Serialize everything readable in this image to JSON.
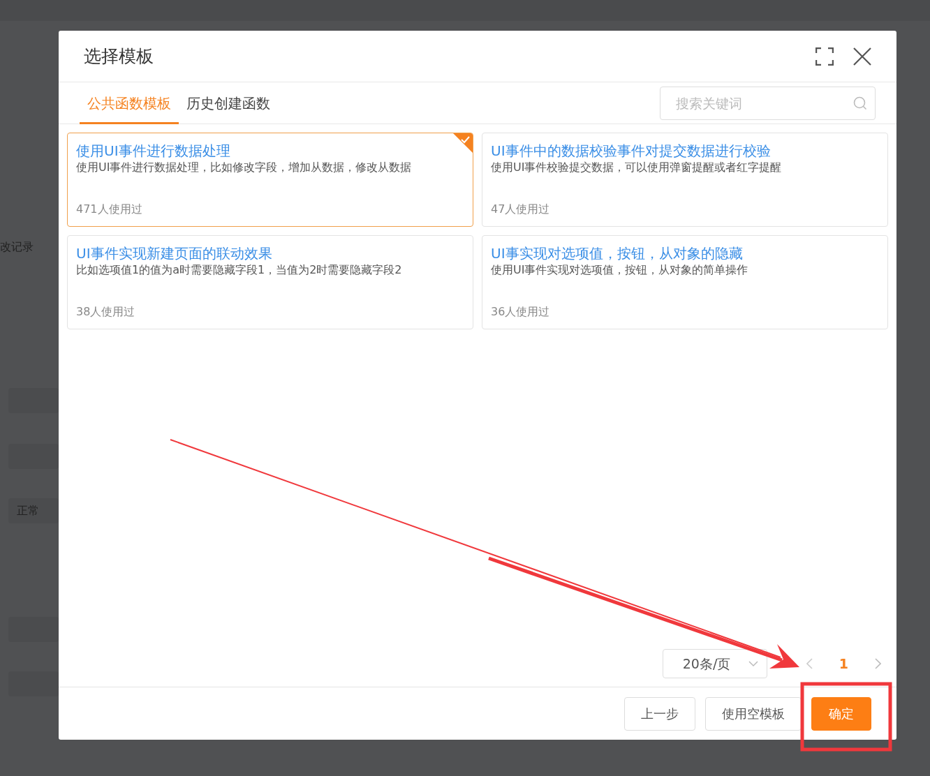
{
  "background": {
    "tab_label": "改记录",
    "status_value": "正常"
  },
  "dialog": {
    "title": "选择模板",
    "tabs": [
      {
        "label": "公共函数模板",
        "selected": true
      },
      {
        "label": "历史创建函数",
        "selected": false
      }
    ],
    "search": {
      "placeholder": "搜索关键词"
    },
    "templates": [
      {
        "title": "使用UI事件进行数据处理",
        "description": "使用UI事件进行数据处理，比如修改字段，增加从数据，修改从数据",
        "usage": "471人使用过",
        "selected": true
      },
      {
        "title": "UI事件中的数据校验事件对提交数据进行校验",
        "description": "使用UI事件校验提交数据，可以使用弹窗提醒或者红字提醒",
        "usage": "47人使用过",
        "selected": false
      },
      {
        "title": "UI事件实现新建页面的联动效果",
        "description": "比如选项值1的值为a时需要隐藏字段1，当值为2时需要隐藏字段2",
        "usage": "38人使用过",
        "selected": false
      },
      {
        "title": "UI事实现对选项值，按钮，从对象的隐藏",
        "description": "使用UI事件实现对选项值，按钮，从对象的简单操作",
        "usage": "36人使用过",
        "selected": false
      }
    ],
    "pagination": {
      "page_size": "20条/页",
      "pages": [
        {
          "label": "1",
          "selected": true
        }
      ]
    },
    "buttons": [
      {
        "label": "上一步",
        "kind": "default"
      },
      {
        "label": "使用空模板",
        "kind": "default"
      },
      {
        "label": "确定",
        "kind": "primary"
      }
    ]
  }
}
